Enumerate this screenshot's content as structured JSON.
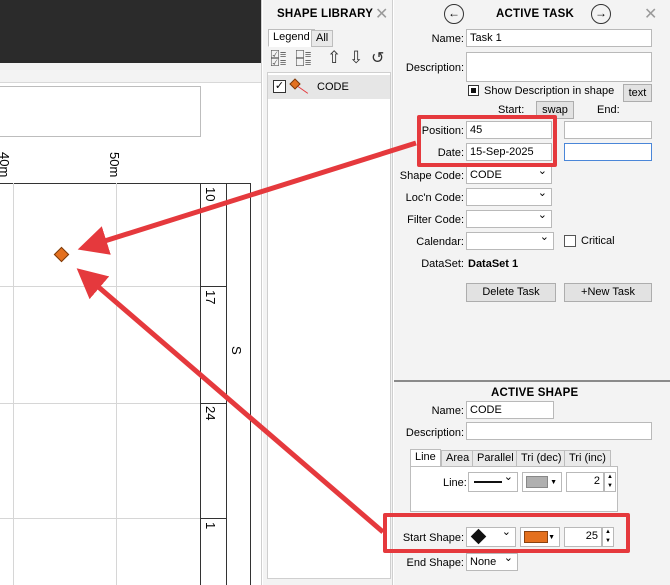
{
  "canvas": {
    "axis_labels": [
      "40m",
      "50m"
    ],
    "side_values": [
      "10",
      "17",
      "24",
      "1"
    ],
    "side_label": "S",
    "marker_color": "#e4701e"
  },
  "shape_library": {
    "title": "SHAPE LIBRARY",
    "close_icon": "close-icon",
    "tabs": [
      "Legend",
      "All"
    ],
    "items": [
      {
        "label": "CODE",
        "checked": true
      }
    ]
  },
  "active_task": {
    "title": "ACTIVE TASK",
    "name_label": "Name:",
    "name_value": "Task 1",
    "description_label": "Description:",
    "description_value": "",
    "show_desc_label": "Show Description in shape",
    "text_button": "text",
    "start_label": "Start:",
    "swap_button": "swap",
    "end_label": "End:",
    "position_label": "Position:",
    "position_value": "45",
    "date_label": "Date:",
    "date_value": "15-Sep-2025",
    "shape_code_label": "Shape Code:",
    "shape_code_value": "CODE",
    "locn_code_label": "Loc'n Code:",
    "filter_code_label": "Filter Code:",
    "calendar_label": "Calendar:",
    "critical_label": "Critical",
    "dataset_label": "DataSet:",
    "dataset_value": "DataSet 1",
    "delete_button": "Delete Task",
    "new_button": "+New Task"
  },
  "active_shape": {
    "title": "ACTIVE SHAPE",
    "name_label": "Name:",
    "name_value": "CODE",
    "description_label": "Description:",
    "tabs": [
      "Line",
      "Area",
      "Parallel",
      "Tri (dec)",
      "Tri (inc)"
    ],
    "line_label": "Line:",
    "line_width": "2",
    "start_shape_label": "Start Shape:",
    "start_shape_size": "25",
    "start_shape_color": "#e4701e",
    "end_shape_label": "End Shape:",
    "end_shape_value": "None"
  },
  "colors": {
    "callout": "#e5393d",
    "marker": "#e4701e",
    "panel_bg": "#f3f3f3"
  }
}
